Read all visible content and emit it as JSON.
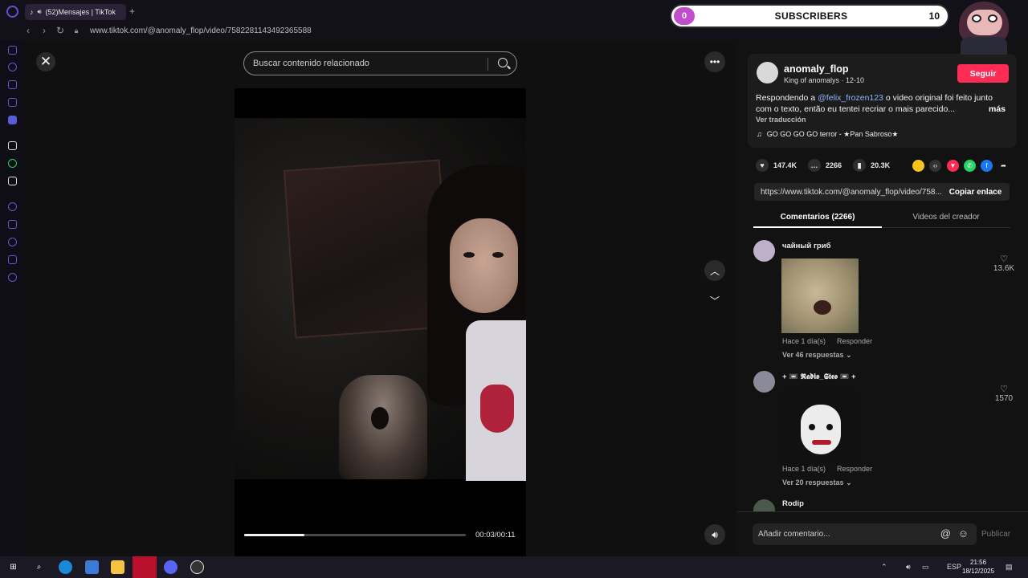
{
  "browser": {
    "tab_title": "(52)Mensajes | TikTok",
    "url": "www.tiktok.com/@anomaly_flop/video/7582281143492365588"
  },
  "stream_overlay": {
    "count": "0",
    "label": "SUBSCRIBERS",
    "goal": "10"
  },
  "player": {
    "search_placeholder": "Buscar contenido relacionado",
    "time": "00:03/00:11",
    "progress": 0.27
  },
  "post": {
    "username": "anomaly_flop",
    "subline": "King of anomalys · 12-10",
    "follow_label": "Seguir",
    "desc_prefix": "Respondendo a ",
    "mention": "@felix_frozen123",
    "desc_rest": " o video original foi feito junto com o texto, então eu tentei recriar o mais parecido...",
    "more_label": "más",
    "translate_label": "Ver traducción",
    "music": "GO GO GO GO terror - ★Pan Sabroso★",
    "likes": "147.4K",
    "comments": "2266",
    "saves": "20.3K",
    "link": "https://www.tiktok.com/@anomaly_flop/video/758...",
    "copy_label": "Copiar enlace"
  },
  "tabs": {
    "comments": "Comentarios (2266)",
    "creator_videos": "Videos del creador"
  },
  "comments": [
    {
      "name": "чайный гриб",
      "meta": "Hace 1 día(s)",
      "reply": "Responder",
      "replies": "Ver 46 respuestas",
      "likes": "13.6K"
    },
    {
      "name": "+ 📼 𝕽𝖆𝖉𝖎𝖔_𝕾𝖙𝖊𝖔 📼 +",
      "meta": "Hace 1 día(s)",
      "reply": "Responder",
      "replies": "Ver 20 respuestas",
      "likes": "1570"
    },
    {
      "name": "Rodip"
    }
  ],
  "composer": {
    "placeholder": "Añadir comentario...",
    "publish": "Publicar"
  },
  "taskbar": {
    "lang": "ESP",
    "time": "21:56",
    "date": "18/12/2025"
  },
  "colors": {
    "accent": "#fe2c55",
    "overlay_badge": "#c04ecb"
  }
}
